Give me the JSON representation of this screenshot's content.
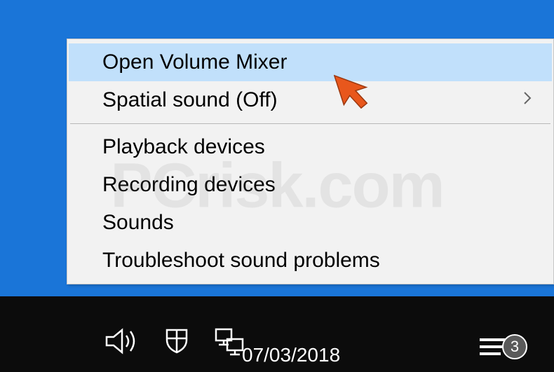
{
  "menu": {
    "items": [
      {
        "label": "Open Volume Mixer",
        "highlighted": true,
        "hasSubmenu": false
      },
      {
        "label": "Spatial sound (Off)",
        "highlighted": false,
        "hasSubmenu": true
      }
    ],
    "items2": [
      {
        "label": "Playback devices"
      },
      {
        "label": "Recording devices"
      },
      {
        "label": "Sounds"
      },
      {
        "label": "Troubleshoot sound problems"
      }
    ]
  },
  "taskbar": {
    "date": "07/03/2018",
    "notificationCount": "3"
  },
  "watermark": "PCrisk.com"
}
